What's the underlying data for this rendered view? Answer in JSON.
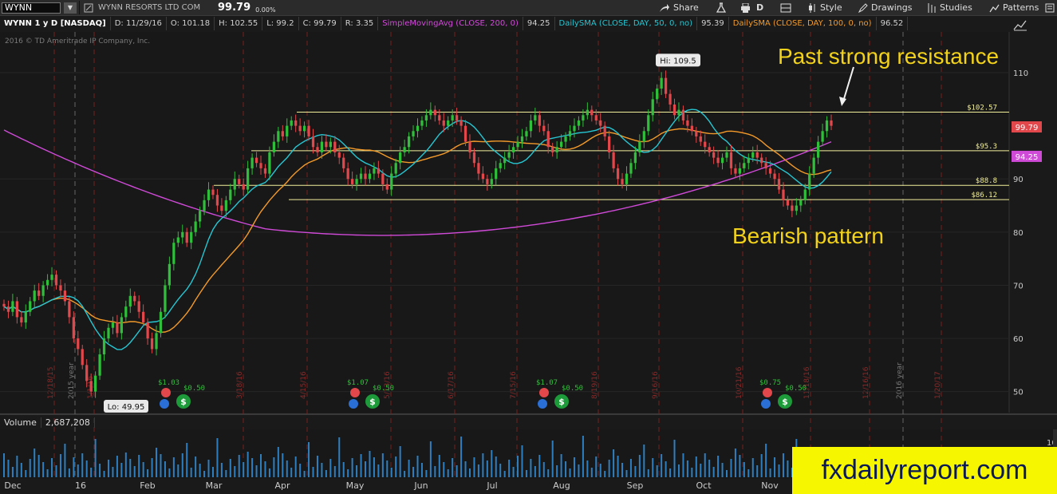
{
  "toolbar": {
    "symbol": "WYNN",
    "company": "WYNN RESORTS LTD COM",
    "last": "99.79",
    "change": "0.00%",
    "share_label": "Share",
    "timeframe": "D",
    "style_label": "Style",
    "drawings_label": "Drawings",
    "studies_label": "Studies",
    "patterns_label": "Patterns"
  },
  "infobar": {
    "title": "WYNN 1 y D [NASDAQ]",
    "date": "D: 11/29/16",
    "open": "O: 101.18",
    "high": "H: 102.55",
    "low": "L: 99.2",
    "close": "C: 99.79",
    "range": "R: 3.35",
    "sma200_label": "SimpleMovingAvg (CLOSE, 200, 0)",
    "sma200_value": "94.25",
    "sma50_label": "DailySMA (CLOSE, DAY, 50, 0, no)",
    "sma50_value": "95.39",
    "sma100_label": "DailySMA (CLOSE, DAY, 100, 0, no)",
    "sma100_value": "96.52"
  },
  "copyright": "2016 © TD Ameritrade IP Company, Inc.",
  "annotations": {
    "resistance": "Past strong resistance",
    "bearish": "Bearish pattern",
    "watermark": "fxdailyreport.com"
  },
  "volume": {
    "label": "Volume",
    "value": "2,687,208"
  },
  "colors": {
    "background": "#1a1a1a",
    "up": "#2fbf3a",
    "down": "#e2474b",
    "sma200": "#d04ad8",
    "sma50": "#26c6d2",
    "sma100": "#f39a2a",
    "level": "#f2ef9a",
    "annotation": "#f2d21a",
    "volume": "#2e7fbf"
  },
  "chart_data": {
    "type": "candlestick",
    "y_axis": {
      "min": 45,
      "max": 113,
      "ticks": [
        50,
        60,
        70,
        80,
        90,
        110
      ],
      "side": "right"
    },
    "x_axis": {
      "month_labels": [
        "Dec",
        "16",
        "Feb",
        "Mar",
        "Apr",
        "May",
        "Jun",
        "Jul",
        "Aug",
        "Sep",
        "Oct",
        "Nov"
      ]
    },
    "event_dates": [
      "12/18/15",
      "2015 year",
      "1/1/16",
      "3/18/16",
      "4/15/16",
      "5/13/16",
      "6/17/16",
      "7/15/16",
      "8/19/16",
      "9/16/16",
      "10/21/16",
      "11/18/16",
      "12/16/16",
      "2016 year",
      "1/20/17"
    ],
    "price_levels": [
      {
        "label": "102.57",
        "value": 102.57
      },
      {
        "label": "95.3",
        "value": 95.3
      },
      {
        "label": "88.8",
        "value": 88.8
      },
      {
        "label": "86.12",
        "value": 86.12
      }
    ],
    "markers": [
      {
        "label": "Hi: 109.5",
        "value": 109.5
      },
      {
        "label": "Lo: 49.95",
        "value": 49.95
      }
    ],
    "current_price_tags": [
      {
        "label": "99.79",
        "value": 99.79,
        "color": "#e2474b"
      },
      {
        "label": "94.25",
        "value": 94.25,
        "color": "#d04ad8"
      }
    ],
    "dividends": [
      {
        "dividend": "$1.03",
        "special": "$0.50"
      },
      {
        "dividend": "$1.07",
        "special": "$0.50"
      },
      {
        "dividend": "$1.07",
        "special": "$0.50"
      },
      {
        "dividend": "$0.75",
        "special": "$0.50"
      }
    ],
    "close_series": [
      66,
      65,
      67,
      64,
      63,
      65,
      67,
      69,
      68,
      70,
      71,
      72,
      70,
      69,
      67,
      64,
      60,
      58,
      55,
      52,
      50,
      53,
      57,
      60,
      62,
      63,
      61,
      64,
      66,
      68,
      67,
      65,
      63,
      60,
      58,
      61,
      65,
      70,
      74,
      78,
      79,
      80,
      78,
      80,
      82,
      84,
      86,
      88,
      87,
      85,
      84,
      86,
      88,
      90,
      89,
      88,
      92,
      94,
      93,
      92,
      91,
      95,
      97,
      99,
      98,
      100,
      101,
      100,
      99,
      100,
      98,
      96,
      95,
      97,
      96,
      97,
      95,
      94,
      92,
      90,
      89,
      90,
      91,
      90,
      91,
      92,
      91,
      89,
      88,
      91,
      93,
      95,
      96,
      98,
      99,
      100,
      101,
      102,
      103,
      102,
      101,
      100,
      101,
      102,
      101,
      100,
      97,
      95,
      93,
      91,
      90,
      89,
      90,
      92,
      93,
      94,
      95,
      96,
      97,
      98,
      99,
      101,
      102,
      100,
      99,
      96,
      95,
      96,
      97,
      98,
      99,
      100,
      101,
      102,
      103,
      102,
      101,
      100,
      98,
      95,
      92,
      90,
      89,
      91,
      93,
      95,
      97,
      99,
      102,
      105,
      107,
      109,
      106,
      104,
      102,
      103,
      101,
      100,
      99,
      98,
      97,
      96,
      95,
      94,
      93,
      94,
      95,
      92,
      91,
      92,
      93,
      94,
      95,
      94,
      93,
      92,
      91,
      90,
      88,
      86,
      85,
      84,
      85,
      86,
      88,
      91,
      94,
      97,
      99,
      101,
      100
    ]
  }
}
